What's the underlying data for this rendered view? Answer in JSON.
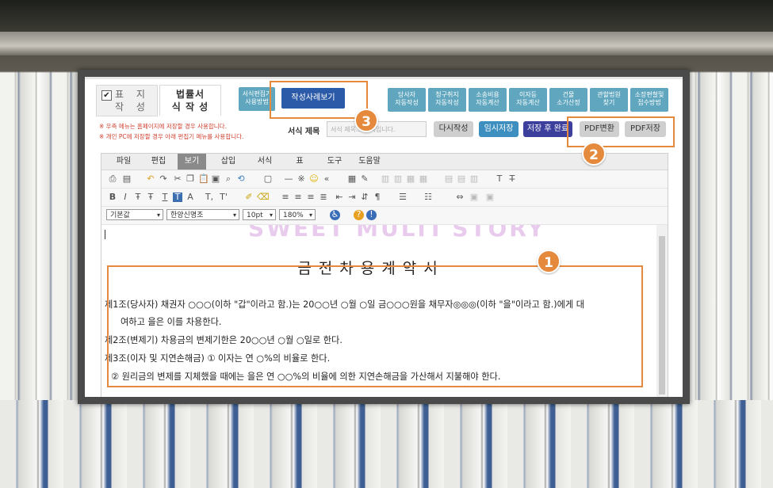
{
  "tabs": {
    "form_write": "표 지 작 성",
    "legal_form_write": "법률서식 작 성"
  },
  "buttons": {
    "editor_guide": [
      "서식편집기",
      "사용방법"
    ],
    "view_examples": "작성사례보기",
    "right_group": [
      [
        "당사자",
        "자동작성"
      ],
      [
        "청구취지",
        "자동작성"
      ],
      [
        "소송비용",
        "자동계산"
      ],
      [
        "이자등",
        "자동계산"
      ],
      [
        "건물",
        "소가산정"
      ],
      [
        "관할법원",
        "찾기"
      ],
      [
        "소장편철및",
        "접수방법"
      ]
    ],
    "rewrite": "다시작성",
    "temp_save": "임시저장",
    "save_complete": "저장 후 완료",
    "pdf_convert": "PDF변환",
    "pdf_save": "PDF저장"
  },
  "notes": [
    "※ 우측 메뉴는 홈페이지에 저장할 경우 사용합니다.",
    "※ 개인 PC에 저장할 경우 아래 편집기 메뉴를 사용합니다."
  ],
  "form_title_label": "서식 제목",
  "form_title_placeholder": "서식 제목... 항목입니다.",
  "menu": [
    "파일",
    "편집",
    "보기",
    "삽입",
    "서식",
    "표",
    "도구",
    "도움말"
  ],
  "active_menu": "보기",
  "toolbar": {
    "style": "기본값",
    "font": "한양신명조",
    "size": "10pt",
    "zoom": "180%"
  },
  "watermark": "SWEET MULTI STORY",
  "document": {
    "title": "금전차용계약서",
    "lines": [
      "제1조(당사자) 채권자 ○○○(이하 \"갑\"이라고 함.)는 20○○년 ○월 ○일 금○○○원을 채무자◎◎◎(이하 \"을\"이라고 함.)에게 대",
      "여하고 을은 이를 차용한다.",
      "제2조(변제기) 차용금의 변제기한은 20○○년 ○월 ○일로 한다.",
      "제3조(이자 및 지연손해금) ① 이자는 연 ○%의 비율로 한다.",
      "② 원리금의 변제를 지체했을 때에는 을은 연 ○○%의 비율에 의한 지연손해금을 가산해서 지불해야 한다."
    ]
  },
  "callouts": [
    "1",
    "2",
    "3"
  ],
  "colors": {
    "accent": "#e58a3c",
    "button_teal": "#5fa6be",
    "button_navy": "#2b5aa8"
  }
}
